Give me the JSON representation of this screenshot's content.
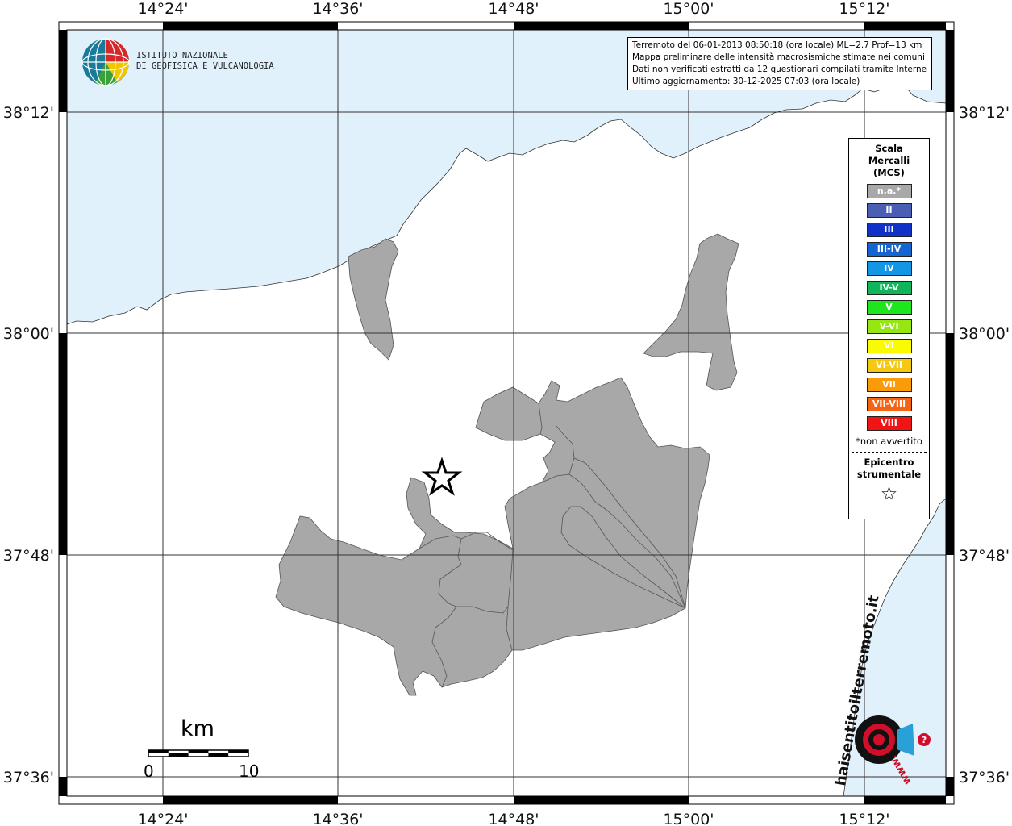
{
  "map": {
    "x_ticks": [
      "14°24'",
      "14°36'",
      "14°48'",
      "15°00'",
      "15°12'"
    ],
    "y_ticks": [
      "38°12'",
      "38°00'",
      "37°48'",
      "37°36'"
    ],
    "colors": {
      "sea": "#e1f1fc",
      "land": "#ffffff",
      "felt": "#a8a8a8",
      "frame": "#000000"
    }
  },
  "logo": {
    "line1": "ISTITUTO NAZIONALE",
    "line2": "DI GEOFISICA E VULCANOLOGIA",
    "icon": "globe-icon"
  },
  "info": {
    "line1": "Terremoto del 06-01-2013 08:50:18 (ora locale) ML=2.7 Prof=13 km",
    "line2": "Mappa preliminare delle intensità macrosismiche stimate nei comuni",
    "line3": "Dati non verificati estratti da 12 questionari compilati tramite Internet.",
    "line4": "Ultimo aggiornamento: 30-12-2025 07:03 (ora locale)"
  },
  "legend": {
    "title_line1": "Scala",
    "title_line2": "Mercalli",
    "title_line3": "(MCS)",
    "classes": [
      {
        "label": "n.a.*",
        "color": "#a8a8a8"
      },
      {
        "label": "II",
        "color": "#4a5fb4"
      },
      {
        "label": "III",
        "color": "#1032c8"
      },
      {
        "label": "III-IV",
        "color": "#1464d2"
      },
      {
        "label": "IV",
        "color": "#1496e6"
      },
      {
        "label": "IV-V",
        "color": "#10b45a"
      },
      {
        "label": "V",
        "color": "#1ee61e"
      },
      {
        "label": "V-VI",
        "color": "#96e614"
      },
      {
        "label": "VI",
        "color": "#fafa00"
      },
      {
        "label": "VI-VII",
        "color": "#f5c814"
      },
      {
        "label": "VII",
        "color": "#fa9b0a"
      },
      {
        "label": "VII-VIII",
        "color": "#f56414"
      },
      {
        "label": "VIII",
        "color": "#f01414"
      }
    ],
    "note": "*non avvertito",
    "epicenter_line1": "Epicentro",
    "epicenter_line2": "strumentale",
    "epicenter_icon": "star-icon"
  },
  "scale_bar": {
    "unit": "km",
    "start": "0",
    "end": "10"
  },
  "watermark": {
    "text": "haisentitoilterremoto.it",
    "url": "www.",
    "icon": "target-icon"
  }
}
